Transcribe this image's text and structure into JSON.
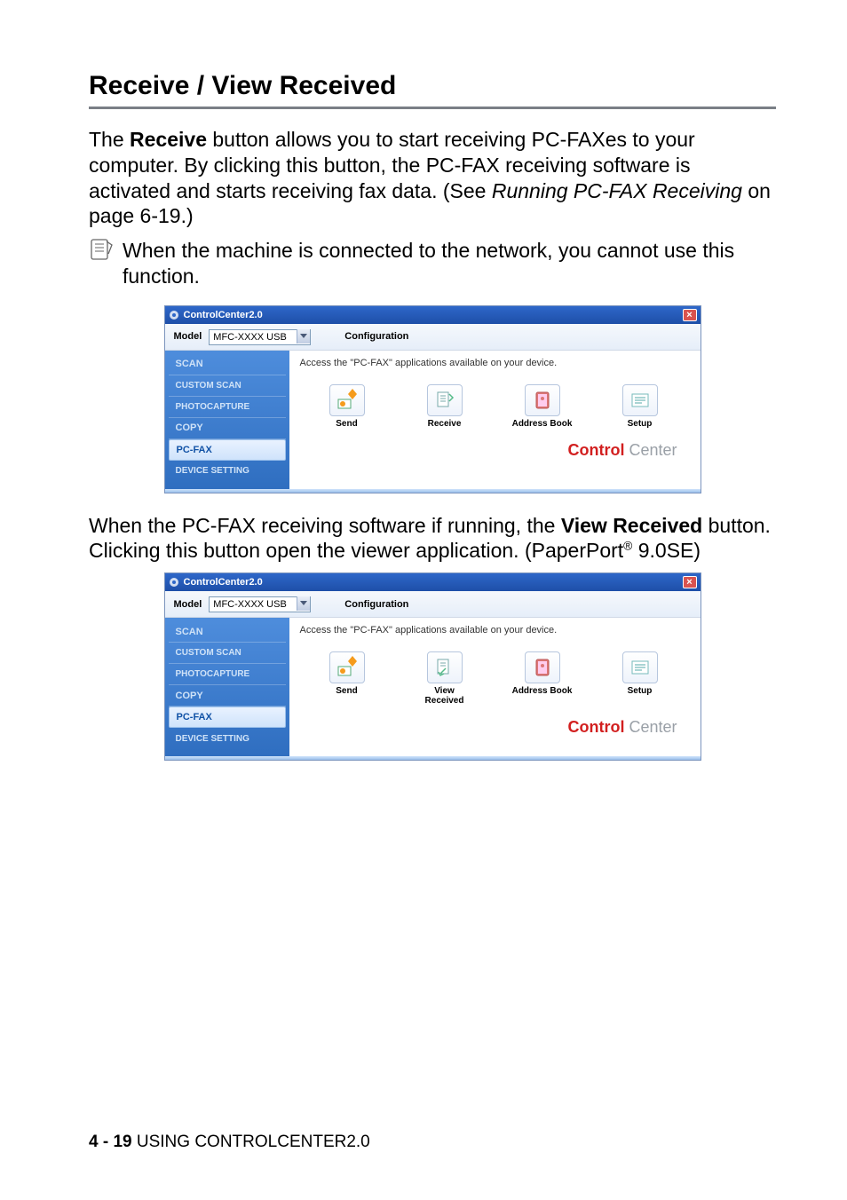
{
  "heading": "Receive / View Received",
  "para1_a": "The ",
  "para1_bold1": "Receive",
  "para1_b": " button allows you to start receiving PC-FAXes to your computer. By clicking this button, the PC-FAX receiving software is activated and starts receiving fax data. (See ",
  "para1_ital": "Running PC-FAX Receiving",
  "para1_c": " on page 6-19.)",
  "note_text": "When the machine is connected to the network, you cannot use this function.",
  "para2_a": "When the PC-FAX receiving software if running, the ",
  "para2_bold": "View Received",
  "para2_b": " button. Clicking this button open the viewer application. (PaperPort",
  "para2_sup": "®",
  "para2_c": " 9.0SE)",
  "app": {
    "title": "ControlCenter2.0",
    "close": "×",
    "model_label": "Model",
    "model_value": "MFC-XXXX USB",
    "config_label": "Configuration",
    "desc": "Access the \"PC-FAX\" applications available on your device.",
    "sidebar": {
      "scan": "SCAN",
      "custom": "CUSTOM SCAN",
      "photo": "PHOTOCAPTURE",
      "copy": "COPY",
      "pcfax": "PC-FAX",
      "device": "DEVICE SETTING"
    },
    "buttons1": {
      "send": "Send",
      "receive": "Receive",
      "address": "Address Book",
      "setup": "Setup"
    },
    "buttons2": {
      "send": "Send",
      "view": "View\nReceived",
      "address": "Address Book",
      "setup": "Setup"
    },
    "brand_red": "Control",
    "brand_grey": " Center"
  },
  "footer": {
    "page": "4 - 19",
    "label": "   USING CONTROLCENTER2.0"
  }
}
